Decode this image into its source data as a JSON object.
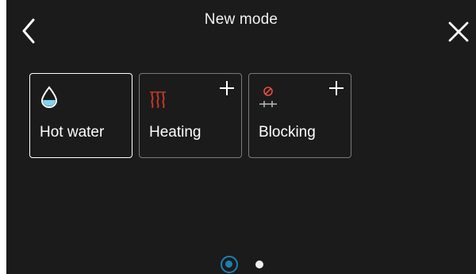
{
  "header": {
    "title": "New mode",
    "back_icon": "chevron-left-icon",
    "close_icon": "close-icon"
  },
  "modes": [
    {
      "label": "Hot water",
      "icon": "water-drop-icon",
      "selected": true,
      "has_add": false
    },
    {
      "label": "Heating",
      "icon": "heating-icon",
      "selected": false,
      "has_add": true
    },
    {
      "label": "Blocking",
      "icon": "blocking-icon",
      "selected": false,
      "has_add": true
    }
  ],
  "pager": {
    "pages": 2,
    "current": 1
  },
  "colors": {
    "background": "#1b1b1b",
    "accent": "#1e7fb1",
    "water": "#7fd3f0",
    "heating": "#c0392b",
    "blocking": "#e74c3c"
  }
}
